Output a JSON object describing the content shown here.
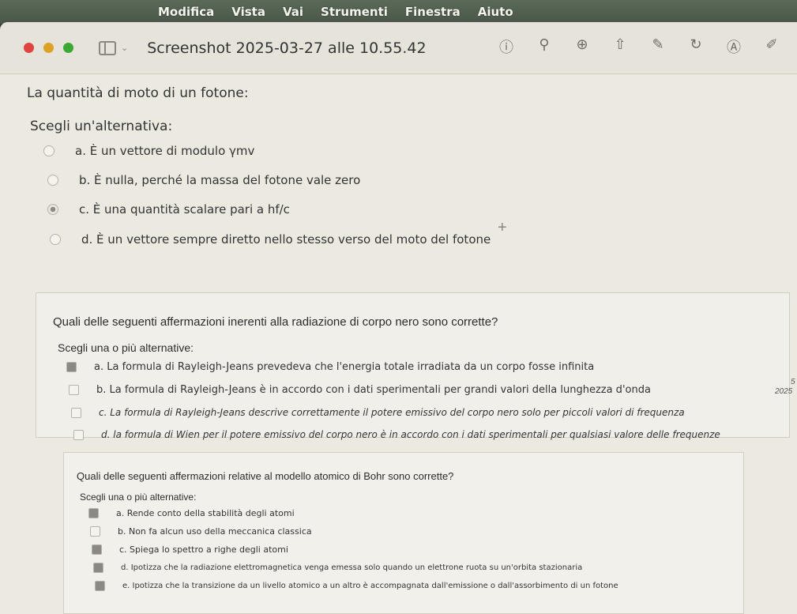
{
  "menubar": {
    "items": [
      "Modifica",
      "Vista",
      "Vai",
      "Strumenti",
      "Finestra",
      "Aiuto"
    ]
  },
  "window": {
    "title": "Screenshot 2025-03-27 alle 10.55.42"
  },
  "toolbar": {
    "icons": [
      "info-icon",
      "zoom-out-icon",
      "zoom-in-icon",
      "share-icon",
      "markup-pen-icon",
      "rotate-icon",
      "markup-circle-icon",
      "edit-icon"
    ]
  },
  "q1": {
    "text": "La quantità di moto di un fotone:",
    "prompt": "Scegli un'alternativa:",
    "options": [
      "a. È un vettore di modulo γmv",
      "b. È nulla, perché la massa del fotone vale zero",
      "c. È una quantità scalare pari a hf/c",
      "d. È un vettore sempre diretto nello stesso verso del moto del fotone"
    ],
    "selected": "c"
  },
  "q2": {
    "text": "Quali delle seguenti affermazioni inerenti alla radiazione di corpo nero sono corrette?",
    "prompt": "Scegli una o più alternative:",
    "options": [
      "a. La formula di Rayleigh-Jeans prevedeva che l'energia totale irradiata da un corpo fosse infinita",
      "b. La formula di Rayleigh-Jeans è in accordo con i dati sperimentali per grandi valori della lunghezza d'onda",
      "c. La formula di Rayleigh-Jeans descrive correttamente il potere emissivo del corpo nero solo per piccoli valori di frequenza",
      "d. la formula di Wien per il potere emissivo del corpo nero è in accordo con i dati sperimentali per qualsiasi valore delle frequenze"
    ]
  },
  "q3": {
    "text": "Quali delle seguenti affermazioni relative al modello atomico di Bohr sono corrette?",
    "prompt": "Scegli una o più alternative:",
    "options": [
      "a. Rende conto della stabilità degli atomi",
      "b. Non fa alcun uso della meccanica classica",
      "c. Spiega lo spettro a righe degli atomi",
      "d. Ipotizza che la radiazione elettromagnetica venga emessa solo quando un elettrone ruota su un'orbita stazionaria",
      "e. Ipotizza che la transizione da un livello atomico a un altro è accompagnata dall'emissione o dall'assorbimento di un fotone"
    ]
  },
  "side_note": {
    "line1": "5",
    "line2": "2025"
  }
}
